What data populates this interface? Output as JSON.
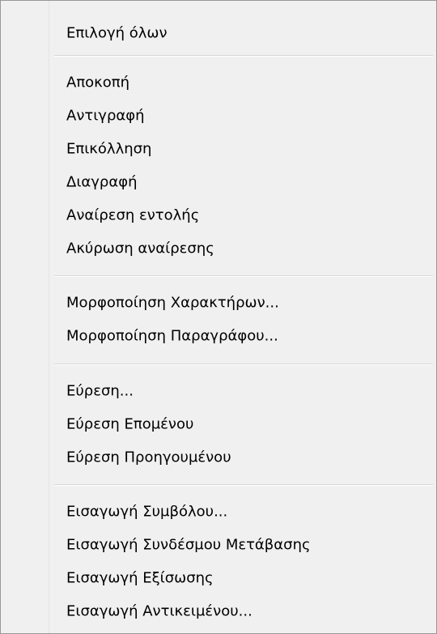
{
  "menu": {
    "groups": [
      {
        "items": [
          "Επιλογή όλων"
        ]
      },
      {
        "items": [
          "Αποκοπή",
          "Αντιγραφή",
          "Επικόλληση",
          "Διαγραφή",
          "Αναίρεση εντολής",
          "Ακύρωση αναίρεσης"
        ]
      },
      {
        "items": [
          "Μορφοποίηση Χαρακτήρων...",
          "Μορφοποίηση Παραγράφου..."
        ]
      },
      {
        "items": [
          "Εύρεση...",
          "Εύρεση Επομένου",
          "Εύρεση Προηγουμένου"
        ]
      },
      {
        "items": [
          "Εισαγωγή Συμβόλου...",
          "Εισαγωγή Συνδέσμου Μετάβασης",
          "Εισαγωγή Εξίσωσης",
          "Εισαγωγή Αντικειμένου..."
        ]
      }
    ]
  }
}
